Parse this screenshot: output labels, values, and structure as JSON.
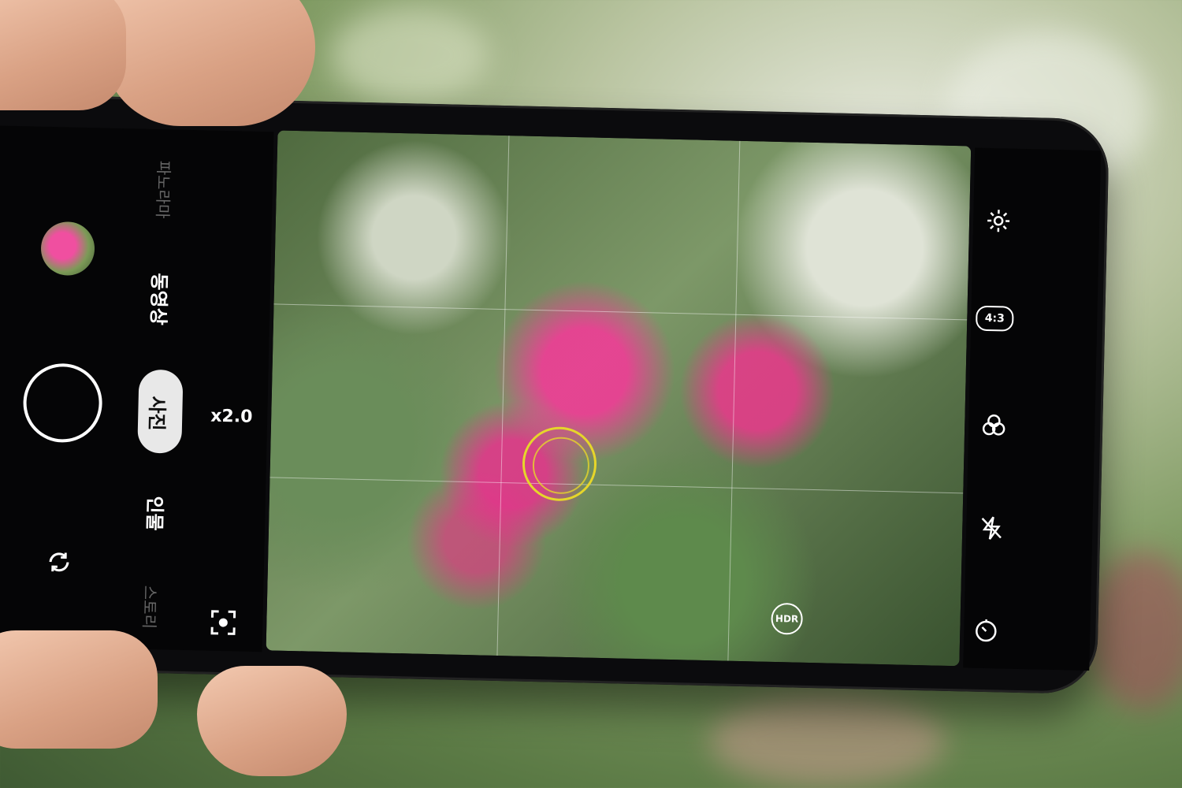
{
  "camera": {
    "modes": {
      "photo": "사진",
      "video": "동영상",
      "portrait": "인물",
      "panorama": "파노라마",
      "story": "스토리"
    },
    "zoom": "x2.0",
    "aspect_ratio": "4:3",
    "hdr_label": "HDR"
  },
  "colors": {
    "focus_ring": "#e6d62a",
    "ui_background": "#050506",
    "ui_foreground": "#ffffff"
  },
  "icons": [
    "settings-gear-icon",
    "aspect-ratio-icon",
    "filter-icon",
    "flash-off-icon",
    "timer-icon",
    "switch-camera-icon",
    "scan-icon"
  ]
}
